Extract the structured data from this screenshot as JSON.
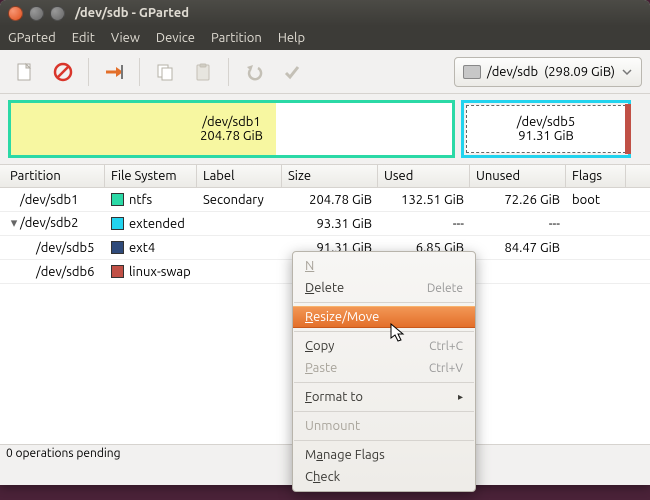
{
  "window": {
    "title": "/dev/sdb - GParted"
  },
  "menubar": [
    "GParted",
    "Edit",
    "View",
    "Device",
    "Partition",
    "Help"
  ],
  "device_selector": {
    "path": "/dev/sdb",
    "size": "(298.09 GiB)"
  },
  "partbar": {
    "p1": {
      "name": "/dev/sdb1",
      "size": "204.78 GiB"
    },
    "p2": {
      "name": "/dev/sdb5",
      "size": "91.31 GiB"
    }
  },
  "columns": {
    "partition": "Partition",
    "fs": "File System",
    "label": "Label",
    "size": "Size",
    "used": "Used",
    "unused": "Unused",
    "flags": "Flags"
  },
  "fs_colors": {
    "ntfs": "#2bd9a6",
    "extended": "#22d3ee",
    "ext4": "#2f4a7a",
    "linux-swap": "#c05046"
  },
  "rows": [
    {
      "partition": "/dev/sdb1",
      "fs": "ntfs",
      "label": "Secondary",
      "size": "204.78 GiB",
      "used": "132.51 GiB",
      "unused": "72.26 GiB",
      "flags": "boot",
      "indent": false,
      "expander": ""
    },
    {
      "partition": "/dev/sdb2",
      "fs": "extended",
      "label": "",
      "size": "93.31 GiB",
      "used": "---",
      "unused": "---",
      "flags": "",
      "indent": false,
      "expander": "▾"
    },
    {
      "partition": "/dev/sdb5",
      "fs": "ext4",
      "label": "",
      "size": "91.31 GiB",
      "used": "6.85 GiB",
      "unused": "84.47 GiB",
      "flags": "",
      "indent": true,
      "expander": ""
    },
    {
      "partition": "/dev/sdb6",
      "fs": "linux-swap",
      "label": "",
      "size": "",
      "used": "",
      "unused": "",
      "flags": "",
      "indent": true,
      "expander": ""
    }
  ],
  "status": "0 operations pending",
  "context_menu": {
    "new": "New",
    "delete": "Delete",
    "delete_accel": "Delete",
    "resize": "Resize/Move",
    "copy": "Copy",
    "copy_accel": "Ctrl+C",
    "paste": "Paste",
    "paste_accel": "Ctrl+V",
    "format": "Format to",
    "unmount": "Unmount",
    "manage_flags": "Manage Flags",
    "check": "Check"
  }
}
